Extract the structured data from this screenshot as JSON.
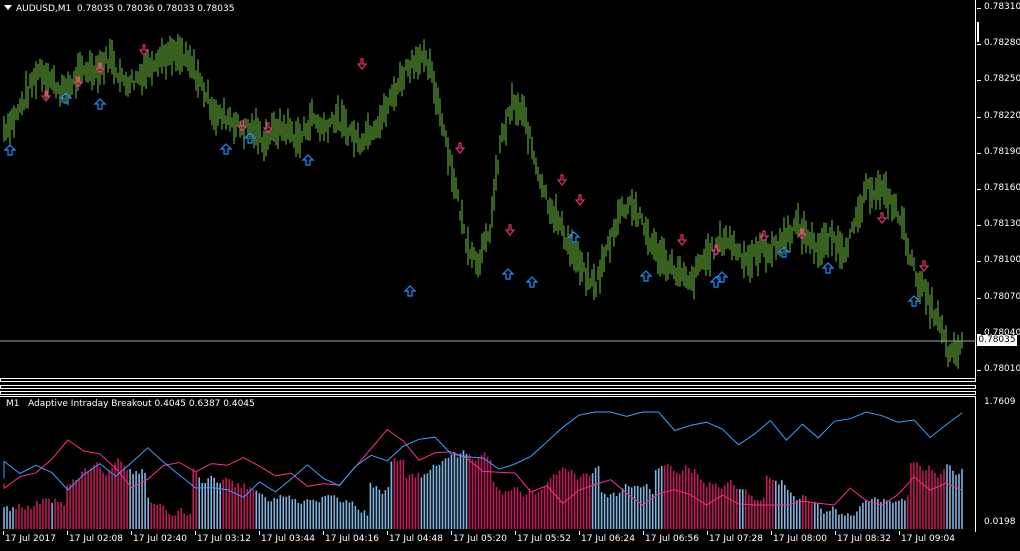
{
  "chart_header": {
    "symbol": "AUDUSD,M1",
    "quote": "0.78035 0.78036 0.78033 0.78035"
  },
  "price_axis": [
    "0.78310",
    "0.78280",
    "0.78250",
    "0.78220",
    "0.78190",
    "0.78160",
    "0.78130",
    "0.78100",
    "0.78070",
    "0.78040",
    "0.78010"
  ],
  "bid_label": "0.78035",
  "indicator": {
    "timeframe": "M1",
    "name": "Adaptive Intraday Breakout",
    "values": "0.4045 0.6387 0.4045",
    "axis_max": "1.7609",
    "axis_min": "0.0198"
  },
  "time_axis": [
    "17 Jul 2017",
    "17 Jul 02:08",
    "17 Jul 02:40",
    "17 Jul 03:12",
    "17 Jul 03:44",
    "17 Jul 04:16",
    "17 Jul 04:48",
    "17 Jul 05:20",
    "17 Jul 05:52",
    "17 Jul 06:24",
    "17 Jul 06:56",
    "17 Jul 07:28",
    "17 Jul 08:00",
    "17 Jul 08:32",
    "17 Jul 09:04"
  ],
  "colors": {
    "bars": "#6fbf3c",
    "up_arrow": "#1e90ff",
    "down_arrow": "#e0306a",
    "ind_red": "#c2185b",
    "ind_blue": "#7fb3e0",
    "line_red": "#ff2d8a",
    "line_blue": "#3aa0ff"
  },
  "chart_data": {
    "type": "line",
    "title": "AUDUSD,M1",
    "ylim": [
      0.77995,
      0.7832
    ],
    "close_path_points": [
      0.7821,
      0.7822,
      0.7824,
      0.7826,
      0.7825,
      0.7824,
      0.7825,
      0.7826,
      0.7826,
      0.7827,
      0.7825,
      0.7825,
      0.7826,
      0.7827,
      0.7827,
      0.7827,
      0.7826,
      0.7824,
      0.7822,
      0.7822,
      0.7821,
      0.7821,
      0.782,
      0.7821,
      0.7821,
      0.782,
      0.7822,
      0.7821,
      0.7822,
      0.7821,
      0.782,
      0.7821,
      0.7822,
      0.7824,
      0.7826,
      0.7827,
      0.7826,
      0.7822,
      0.7817,
      0.7812,
      0.781,
      0.7812,
      0.782,
      0.7823,
      0.7822,
      0.7818,
      0.7815,
      0.7813,
      0.7811,
      0.7809,
      0.7808,
      0.7811,
      0.7814,
      0.7815,
      0.7813,
      0.7811,
      0.781,
      0.7809,
      0.7808,
      0.781,
      0.7811,
      0.7812,
      0.7811,
      0.781,
      0.7811,
      0.7811,
      0.7812,
      0.7813,
      0.7812,
      0.7811,
      0.7812,
      0.7811,
      0.7813,
      0.7816,
      0.7816,
      0.7815,
      0.7813,
      0.7809,
      0.7807,
      0.7805,
      0.7802,
      0.7803
    ]
  }
}
